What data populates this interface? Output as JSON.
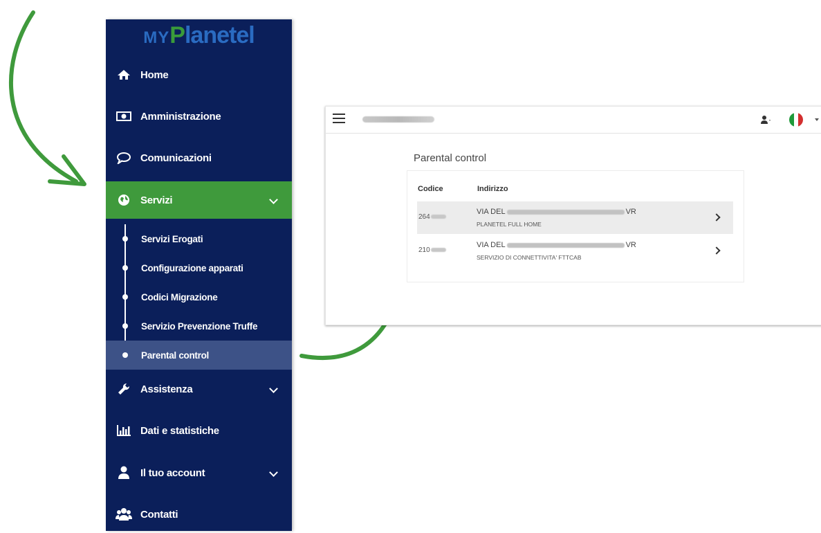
{
  "logo": {
    "my": "MY",
    "planetel_p": "P",
    "planetel_rest": "lanetel"
  },
  "sidebar": {
    "items": [
      {
        "label": "Home",
        "icon": "home-icon"
      },
      {
        "label": "Amministrazione",
        "icon": "money-icon"
      },
      {
        "label": "Comunicazioni",
        "icon": "speech-bubble-icon"
      },
      {
        "label": "Servizi",
        "icon": "globe-icon",
        "active": true
      },
      {
        "label": "Assistenza",
        "icon": "wrench-icon"
      },
      {
        "label": "Dati e statistiche",
        "icon": "bar-chart-icon"
      },
      {
        "label": "Il tuo account",
        "icon": "user-icon"
      },
      {
        "label": "Contatti",
        "icon": "users-icon"
      }
    ],
    "servizi_sub": [
      {
        "label": "Servizi Erogati"
      },
      {
        "label": "Configurazione apparati"
      },
      {
        "label": "Codici Migrazione"
      },
      {
        "label": "Servizio Prevenzione Truffe"
      },
      {
        "label": "Parental control",
        "selected": true
      }
    ]
  },
  "panel": {
    "title": "Parental control",
    "columns": {
      "code": "Codice",
      "address": "Indirizzo"
    },
    "rows": [
      {
        "code_prefix": "264",
        "addr_prefix": "VIA DEL",
        "addr_suffix": "VR",
        "service": "PLANETEL FULL HOME"
      },
      {
        "code_prefix": "210",
        "addr_prefix": "VIA DEL",
        "addr_suffix": "VR",
        "service": "SERVIZIO DI CONNETTIVITA' FTTCAB"
      }
    ]
  },
  "colors": {
    "sidebar_bg": "#0b1f5a",
    "active_green": "#3f9a3c",
    "selected_sub": "#3d5287",
    "arrow_green": "#3f9a3c",
    "logo_blue": "#2a6bc1"
  }
}
